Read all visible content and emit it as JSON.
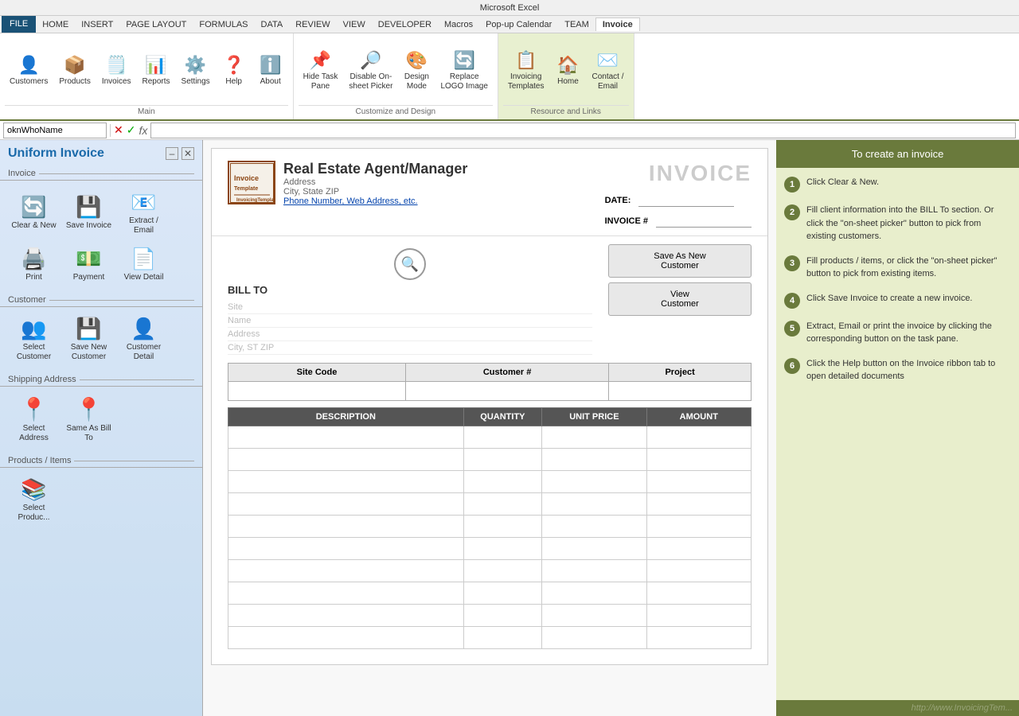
{
  "titleBar": {
    "text": "Microsoft Excel"
  },
  "menuBar": {
    "items": [
      "FILE",
      "HOME",
      "INSERT",
      "PAGE LAYOUT",
      "FORMULAS",
      "DATA",
      "REVIEW",
      "VIEW",
      "DEVELOPER",
      "Macros",
      "Pop-up Calendar",
      "TEAM",
      "Invoice"
    ]
  },
  "ribbon": {
    "groups": [
      {
        "name": "Main",
        "buttons": [
          {
            "id": "customers",
            "icon": "👤",
            "label": "Customers"
          },
          {
            "id": "products",
            "icon": "📦",
            "label": "Products"
          },
          {
            "id": "invoices",
            "icon": "🗒️",
            "label": "Invoices"
          },
          {
            "id": "reports",
            "icon": "📊",
            "label": "Reports"
          },
          {
            "id": "settings",
            "icon": "⚙️",
            "label": "Settings"
          },
          {
            "id": "help",
            "icon": "❓",
            "label": "Help"
          },
          {
            "id": "about",
            "icon": "ℹ️",
            "label": "About"
          }
        ]
      },
      {
        "name": "Customize and Design",
        "buttons": [
          {
            "id": "hide-task",
            "icon": "📌",
            "label": "Hide Task\nPane"
          },
          {
            "id": "on-sheet",
            "icon": "🔎",
            "label": "Disable On-\nsheet Picker"
          },
          {
            "id": "design",
            "icon": "🎨",
            "label": "Design\nMode"
          },
          {
            "id": "replace-logo",
            "icon": "🔄",
            "label": "Replace\nLOGO Image"
          }
        ]
      },
      {
        "name": "Resource and Links",
        "buttons": [
          {
            "id": "templates",
            "icon": "📋",
            "label": "Invoicing\nTemplates"
          },
          {
            "id": "home",
            "icon": "🏠",
            "label": "Home"
          },
          {
            "id": "contact",
            "icon": "✉️",
            "label": "Contact /\nEmail"
          }
        ]
      }
    ]
  },
  "formulaBar": {
    "nameBox": "oknWhoName",
    "cancelIcon": "✕",
    "confirmIcon": "✓",
    "fxIcon": "fx",
    "formula": ""
  },
  "taskPane": {
    "title": "Uniform Invoice",
    "sections": [
      {
        "name": "Invoice",
        "buttons": [
          {
            "id": "clear-new",
            "icon": "🔄",
            "label": "Clear & New",
            "color": "#4a90d9"
          },
          {
            "id": "save-invoice",
            "icon": "💾",
            "label": "Save Invoice",
            "color": "#c44"
          },
          {
            "id": "extract-email",
            "icon": "📧",
            "label": "Extract /\nEmail",
            "color": "#4a8"
          }
        ]
      },
      {
        "name": "",
        "buttons": [
          {
            "id": "print",
            "icon": "🖨️",
            "label": "Print",
            "color": "#666"
          },
          {
            "id": "payment",
            "icon": "💵",
            "label": "Payment",
            "color": "#a84"
          },
          {
            "id": "view-detail",
            "icon": "📄",
            "label": "View Detail",
            "color": "#48a"
          }
        ]
      },
      {
        "name": "Customer",
        "buttons": [
          {
            "id": "select-customer",
            "icon": "👥",
            "label": "Select\nCustomer",
            "color": "#4a90d9"
          },
          {
            "id": "save-new-customer",
            "icon": "💾",
            "label": "Save New\nCustomer",
            "color": "#c44"
          },
          {
            "id": "customer-detail",
            "icon": "👤",
            "label": "Customer\nDetail",
            "color": "#666"
          }
        ]
      },
      {
        "name": "Shipping Address",
        "buttons": [
          {
            "id": "select-address",
            "icon": "📍",
            "label": "Select\nAddress",
            "color": "#e8a020"
          },
          {
            "id": "same-as-bill",
            "icon": "📍",
            "label": "Same As Bill\nTo",
            "color": "#e05020"
          }
        ]
      },
      {
        "name": "Products / Items",
        "buttons": [
          {
            "id": "select-product",
            "icon": "📚",
            "label": "Select\nProduc...",
            "color": "#4a90d9"
          }
        ]
      }
    ]
  },
  "invoice": {
    "company": {
      "name": "Real Estate Agent/Manager",
      "address": "Address",
      "cityStateZip": "City, State ZIP",
      "phone": "Phone Number, Web Address, etc."
    },
    "title": "INVOICE",
    "dateLabel": "DATE:",
    "invoiceNumLabel": "INVOICE #",
    "billTo": {
      "label": "BILL TO",
      "siteField": "Site",
      "nameField": "Name",
      "addressField": "Address",
      "cityField": "City, ST ZIP"
    },
    "buttons": {
      "saveAsNew": "Save As New\nCustomer",
      "viewCustomer": "View\nCustomer"
    },
    "siteTable": {
      "headers": [
        "Site Code",
        "Customer #",
        "Project"
      ]
    },
    "itemsTable": {
      "headers": [
        "DESCRIPTION",
        "QUANTITY",
        "UNIT PRICE",
        "AMOUNT"
      ],
      "rows": 10
    }
  },
  "instructions": {
    "header": "To create an invoice",
    "steps": [
      {
        "num": "1",
        "text": "Click Clear & New."
      },
      {
        "num": "2",
        "text": "Fill client information into the BILL To section. Or click the \"on-sheet picker\" button to pick from existing customers."
      },
      {
        "num": "3",
        "text": "Fill products / items, or click the \"on-sheet picker\" button to pick from existing items."
      },
      {
        "num": "4",
        "text": "Click Save Invoice to create a new invoice."
      },
      {
        "num": "5",
        "text": "Extract, Email or print the invoice by clicking the corresponding button on the task pane."
      },
      {
        "num": "6",
        "text": "Click the Help button on the Invoice ribbon tab to open detailed documents"
      }
    ],
    "watermark": "http://www.InvoicingTem..."
  }
}
